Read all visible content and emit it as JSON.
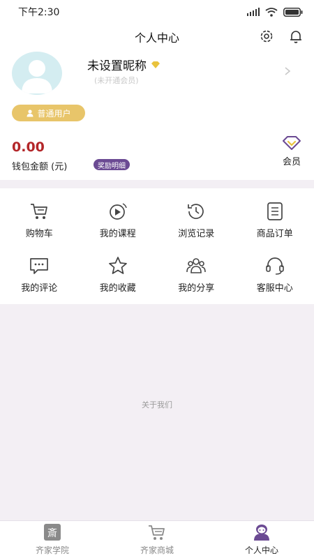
{
  "status_bar": {
    "time": "下午2:30"
  },
  "header": {
    "title": "个人中心"
  },
  "profile": {
    "nickname": "未设置昵称",
    "sub_status": "(未开通会员)",
    "user_type": "普通用户"
  },
  "wallet": {
    "amount": "0.00",
    "label": "钱包金额 (元)",
    "reward_link": "奖励明细",
    "member_label": "会员"
  },
  "menu": [
    {
      "label": "购物车",
      "icon": "shopping-cart-icon"
    },
    {
      "label": "我的课程",
      "icon": "course-play-icon"
    },
    {
      "label": "浏览记录",
      "icon": "history-clock-icon"
    },
    {
      "label": "商品订单",
      "icon": "order-list-icon"
    },
    {
      "label": "我的评论",
      "icon": "comment-icon"
    },
    {
      "label": "我的收藏",
      "icon": "star-icon"
    },
    {
      "label": "我的分享",
      "icon": "share-group-icon"
    },
    {
      "label": "客服中心",
      "icon": "headset-icon"
    }
  ],
  "about": "关于我们",
  "tabs": [
    {
      "label": "齐家学院",
      "icon": "academy-icon",
      "active": false
    },
    {
      "label": "齐家商城",
      "icon": "mall-cart-icon",
      "active": false
    },
    {
      "label": "个人中心",
      "icon": "profile-icon",
      "active": true
    }
  ],
  "colors": {
    "accent_purple": "#6b4a93",
    "wallet_red": "#b32629",
    "badge_gold": "#e8c56a",
    "avatar_bg": "#d4edf1"
  }
}
